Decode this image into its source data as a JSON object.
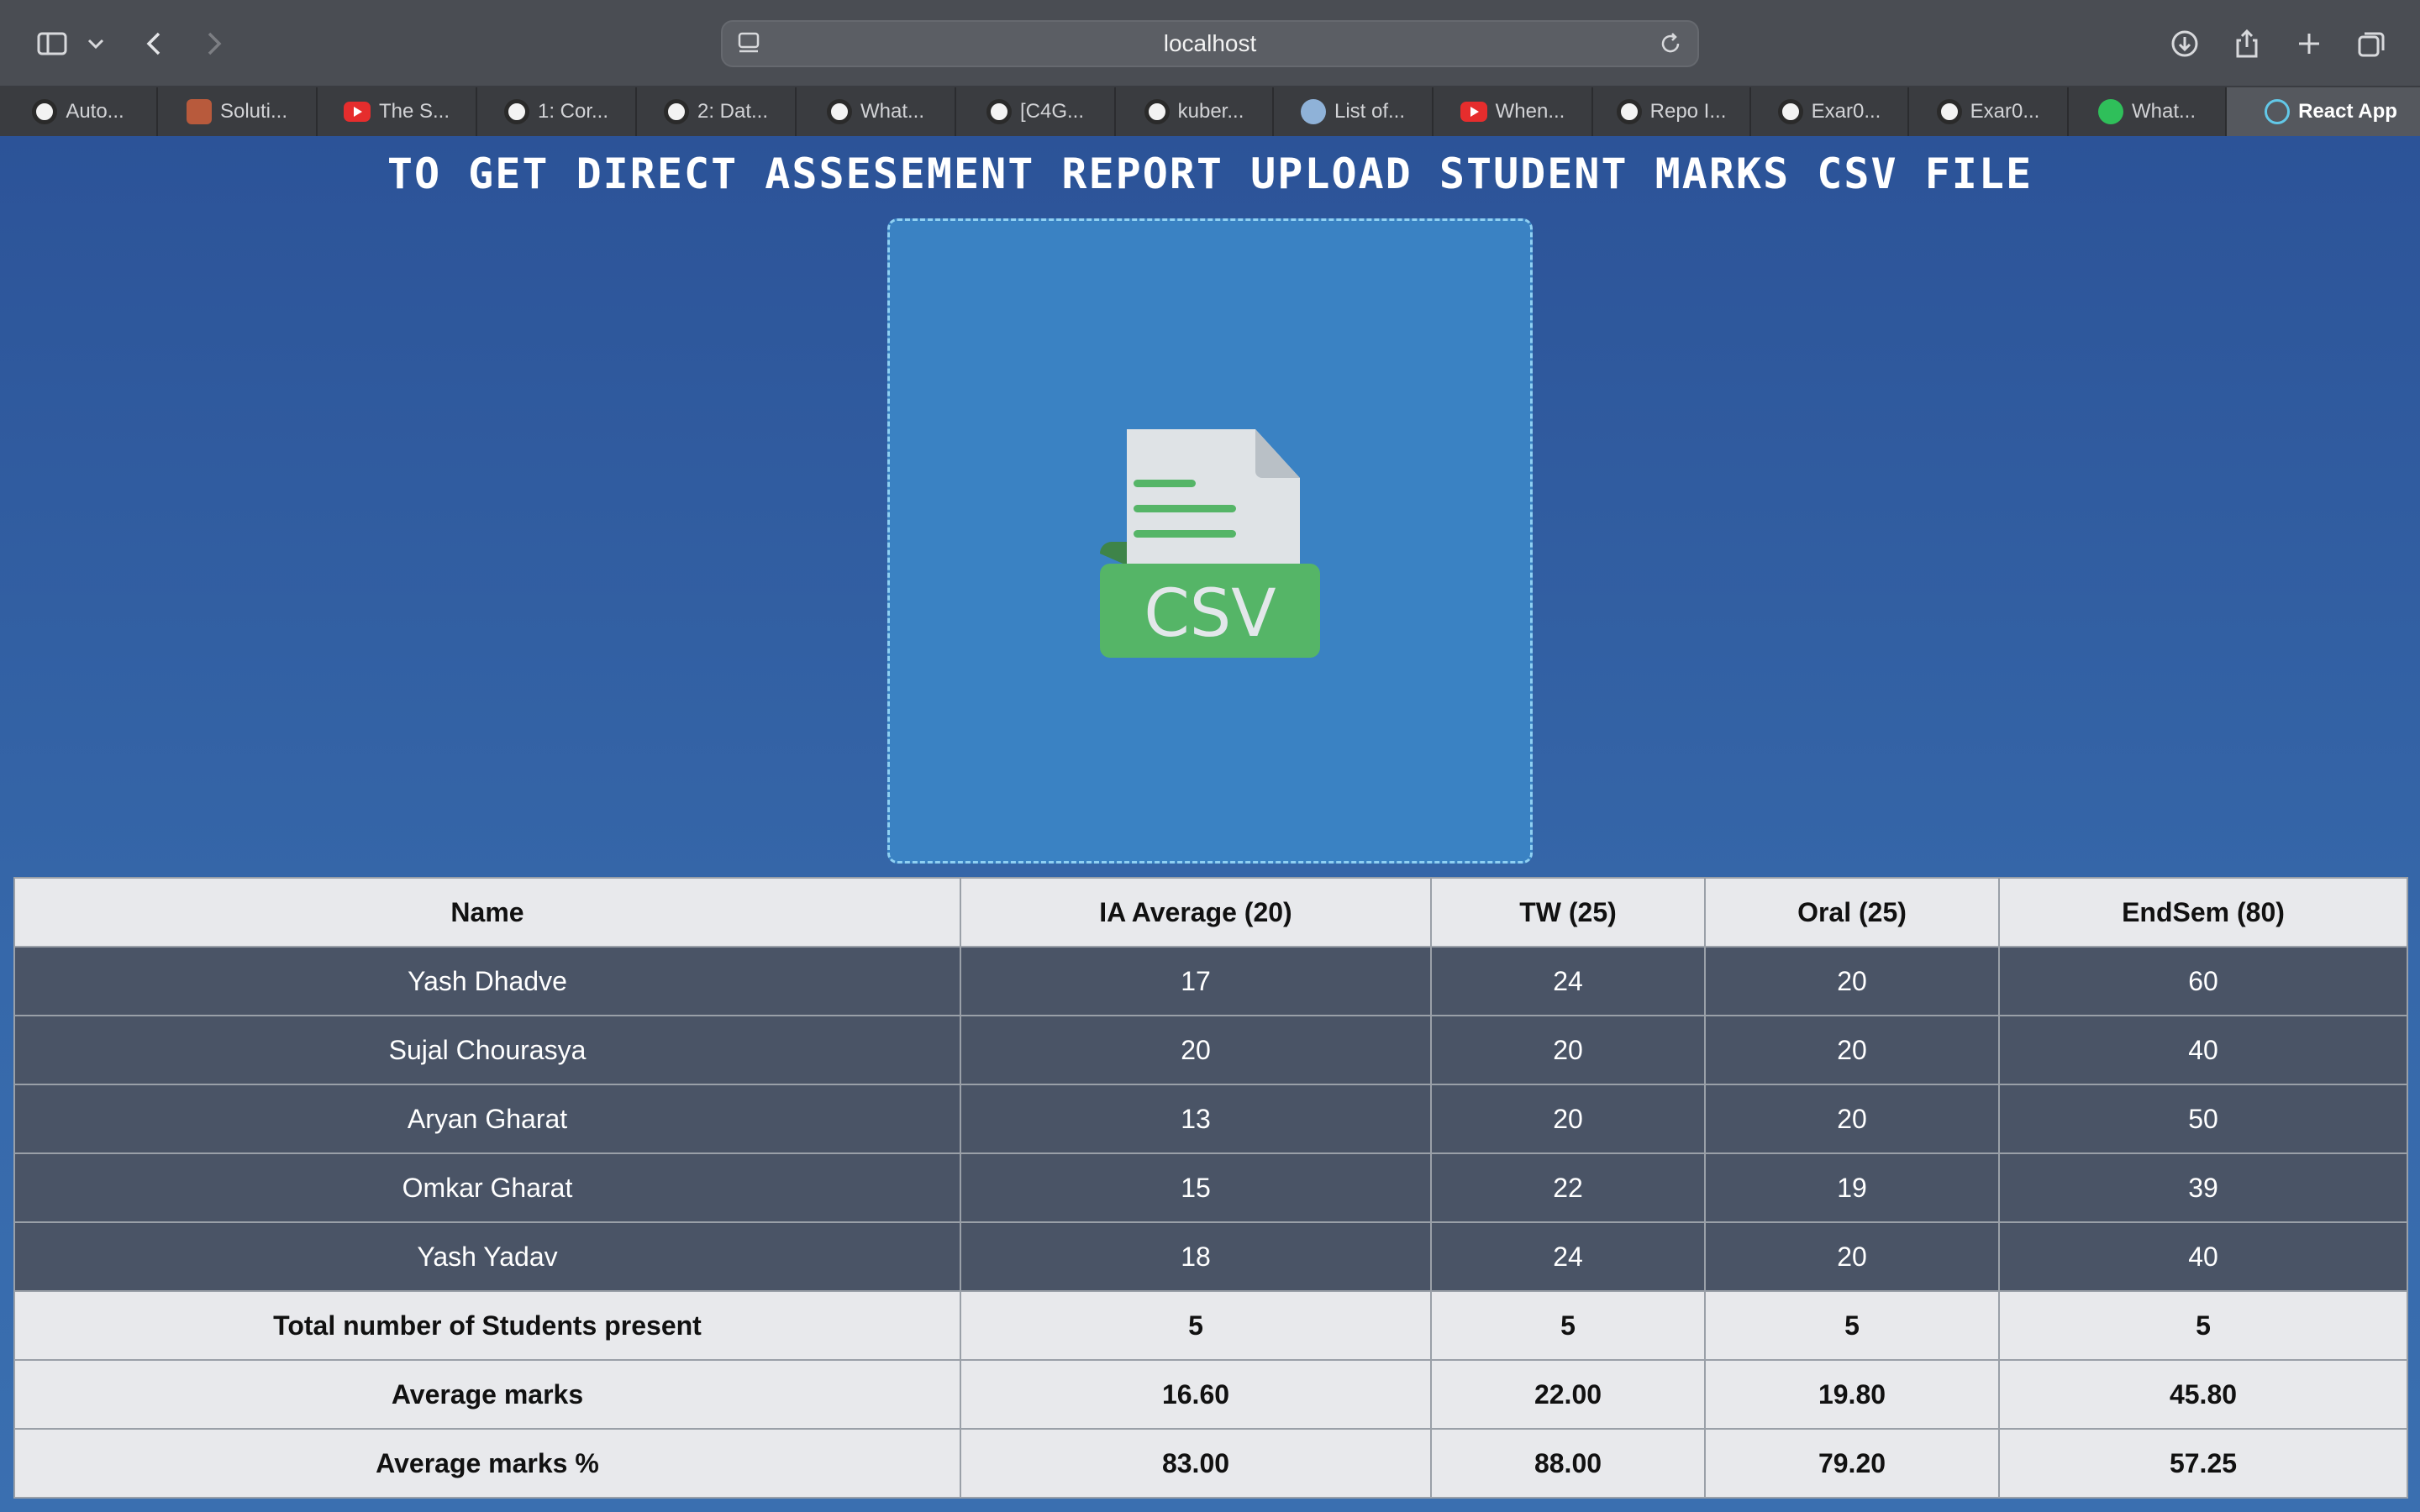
{
  "browser": {
    "url": "localhost",
    "tabs": [
      {
        "label": "Auto...",
        "favicon": "github-icon"
      },
      {
        "label": "Soluti...",
        "favicon": "site-icon"
      },
      {
        "label": "The S...",
        "favicon": "youtube-icon"
      },
      {
        "label": "1: Cor...",
        "favicon": "github-icon"
      },
      {
        "label": "2: Dat...",
        "favicon": "github-icon"
      },
      {
        "label": "What...",
        "favicon": "github-icon"
      },
      {
        "label": "[C4G...",
        "favicon": "github-icon"
      },
      {
        "label": "kuber...",
        "favicon": "github-icon"
      },
      {
        "label": "List of...",
        "favicon": "reddit-icon"
      },
      {
        "label": "When...",
        "favicon": "youtube-icon"
      },
      {
        "label": "Repo I...",
        "favicon": "github-icon"
      },
      {
        "label": "Exar0...",
        "favicon": "github-icon"
      },
      {
        "label": "Exar0...",
        "favicon": "github-icon"
      },
      {
        "label": "What...",
        "favicon": "whatsapp-icon"
      },
      {
        "label": "React App",
        "favicon": "react-icon",
        "active": true
      }
    ]
  },
  "page": {
    "headline": "TO GET DIRECT ASSESEMENT REPORT UPLOAD STUDENT MARKS CSV FILE",
    "upload_icon_text": "CSV"
  },
  "table": {
    "headers": [
      "Name",
      "IA Average (20)",
      "TW (25)",
      "Oral (25)",
      "EndSem (80)"
    ],
    "students": [
      [
        "Yash Dhadve",
        "17",
        "24",
        "20",
        "60"
      ],
      [
        "Sujal Chourasya",
        "20",
        "20",
        "20",
        "40"
      ],
      [
        "Aryan Gharat",
        "13",
        "20",
        "20",
        "50"
      ],
      [
        "Omkar Gharat",
        "15",
        "22",
        "19",
        "39"
      ],
      [
        "Yash Yadav",
        "18",
        "24",
        "20",
        "40"
      ]
    ],
    "summary": [
      [
        "Total number of Students present",
        "5",
        "5",
        "5",
        "5"
      ],
      [
        "Average marks",
        "16.60",
        "22.00",
        "19.80",
        "45.80"
      ],
      [
        "Average marks %",
        "83.00",
        "88.00",
        "79.20",
        "57.25"
      ]
    ]
  },
  "colors": {
    "page_background": "#2f5c9e",
    "dropzone": "#3a82c3",
    "student_row": "#4a5466",
    "header_row": "#e8e9ec",
    "csv_green": "#55b567"
  }
}
